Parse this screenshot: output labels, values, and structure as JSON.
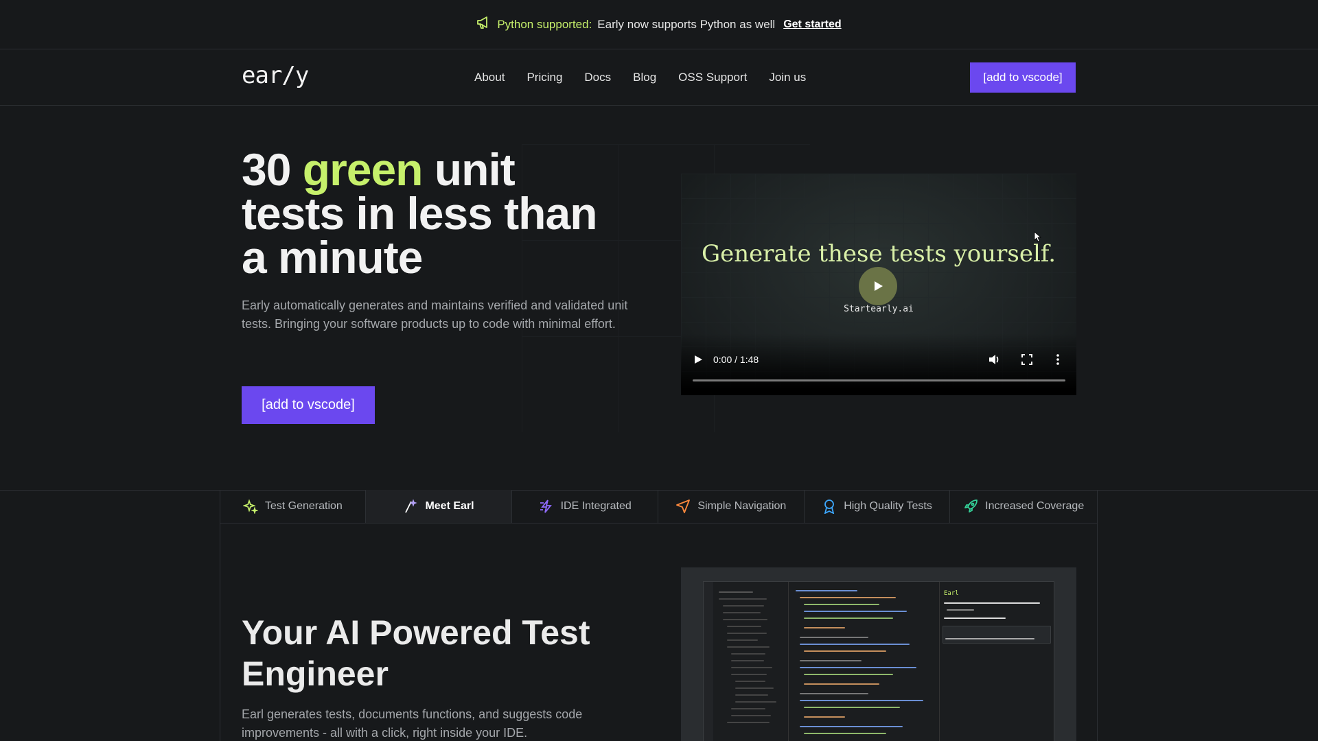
{
  "announcement": {
    "icon": "megaphone-icon",
    "highlight": "Python supported:",
    "message": "Early now supports Python as well",
    "cta": "Get started"
  },
  "nav": {
    "logo": "ear/y",
    "links": [
      "About",
      "Pricing",
      "Docs",
      "Blog",
      "OSS Support",
      "Join us"
    ],
    "cta": "[add to vscode]"
  },
  "hero": {
    "title_pre": "30 ",
    "title_green": "green",
    "title_post": " unit tests in less than a minute",
    "subtitle": "Early automatically generates and maintains verified and validated unit tests. Bringing your software products up to code with minimal effort.",
    "cta": "[add to vscode]"
  },
  "video": {
    "caption": "Generate these tests yourself.",
    "brand": "Startearly.ai",
    "time": "0:00 / 1:48",
    "progress": 0
  },
  "tabs": [
    {
      "label": "Test Generation",
      "icon": "sparkles-icon",
      "active": false
    },
    {
      "label": "Meet Earl",
      "icon": "magic-wand-icon",
      "active": true
    },
    {
      "label": "IDE Integrated",
      "icon": "lightning-icon",
      "active": false
    },
    {
      "label": "Simple Navigation",
      "icon": "navigation-arrow-icon",
      "active": false
    },
    {
      "label": "High Quality Tests",
      "icon": "award-ribbon-icon",
      "active": false
    },
    {
      "label": "Increased Coverage",
      "icon": "rocket-icon",
      "active": false
    }
  ],
  "section2": {
    "title": "Your AI Powered Test Engineer",
    "subtitle": "Earl generates tests, documents functions, and suggests code improvements - all with a click, right inside your IDE.",
    "ide_assistant_label": "Earl"
  },
  "colors": {
    "accent": "#6b48ef",
    "green": "#c6f06b",
    "background": "#17191b"
  }
}
